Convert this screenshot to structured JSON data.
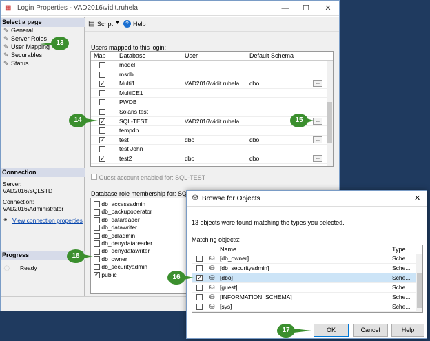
{
  "window": {
    "title": "Login Properties - VAD2016\\vidit.ruhela",
    "minimize": "—",
    "maximize": "☐",
    "close": "✕"
  },
  "left": {
    "select_page": "Select a page",
    "pages": [
      "General",
      "Server Roles",
      "User Mapping",
      "Securables",
      "Status"
    ],
    "connection_header": "Connection",
    "server_label": "Server:",
    "server_value": "VAD2016\\SQLSTD",
    "connection_label": "Connection:",
    "connection_value": "VAD2016\\Administrator",
    "view_props": "View connection properties",
    "progress_header": "Progress",
    "progress_status": "Ready"
  },
  "toolbar": {
    "script": "Script",
    "help": "Help"
  },
  "mapping": {
    "label": "Users mapped to this login:",
    "columns": [
      "Map",
      "Database",
      "User",
      "Default Schema"
    ],
    "rows": [
      {
        "map": false,
        "db": "model",
        "user": "",
        "schema": "",
        "ell": false
      },
      {
        "map": false,
        "db": "msdb",
        "user": "",
        "schema": "",
        "ell": false
      },
      {
        "map": true,
        "db": "Multi1",
        "user": "VAD2016\\vidit.ruhela",
        "schema": "dbo",
        "ell": true
      },
      {
        "map": false,
        "db": "MultiCE1",
        "user": "",
        "schema": "",
        "ell": false
      },
      {
        "map": false,
        "db": "PWDB",
        "user": "",
        "schema": "",
        "ell": false
      },
      {
        "map": false,
        "db": "Solaris test",
        "user": "",
        "schema": "",
        "ell": false
      },
      {
        "map": true,
        "db": "SQL-TEST",
        "user": "VAD2016\\vidit.ruhela",
        "schema": "",
        "ell": true
      },
      {
        "map": false,
        "db": "tempdb",
        "user": "",
        "schema": "",
        "ell": false
      },
      {
        "map": true,
        "db": "test",
        "user": "dbo",
        "schema": "dbo",
        "ell": true
      },
      {
        "map": false,
        "db": "test John",
        "user": "",
        "schema": "",
        "ell": false
      },
      {
        "map": true,
        "db": "test2",
        "user": "dbo",
        "schema": "dbo",
        "ell": true
      }
    ],
    "guest": "Guest account enabled for: SQL-TEST"
  },
  "roles": {
    "label": "Database role membership for: SQL-TEST",
    "items": [
      {
        "name": "db_accessadmin",
        "on": false
      },
      {
        "name": "db_backupoperator",
        "on": false
      },
      {
        "name": "db_datareader",
        "on": false
      },
      {
        "name": "db_datawriter",
        "on": false
      },
      {
        "name": "db_ddladmin",
        "on": false
      },
      {
        "name": "db_denydatareader",
        "on": false
      },
      {
        "name": "db_denydatawriter",
        "on": false
      },
      {
        "name": "db_owner",
        "on": false
      },
      {
        "name": "db_securityadmin",
        "on": false
      },
      {
        "name": "public",
        "on": true
      }
    ]
  },
  "dialog": {
    "title": "Browse for Objects",
    "close": "✕",
    "found": "13 objects were found matching the types you selected.",
    "matching": "Matching objects:",
    "columns": [
      "Name",
      "Type"
    ],
    "rows": [
      {
        "name": "[db_owner]",
        "type": "Sche...",
        "on": false
      },
      {
        "name": "[db_securityadmin]",
        "type": "Sche...",
        "on": false
      },
      {
        "name": "[dbo]",
        "type": "Sche...",
        "on": true
      },
      {
        "name": "[guest]",
        "type": "Sche...",
        "on": false
      },
      {
        "name": "[INFORMATION_SCHEMA]",
        "type": "Sche...",
        "on": false
      },
      {
        "name": "[sys]",
        "type": "Sche...",
        "on": false
      }
    ],
    "ok": "OK",
    "cancel": "Cancel",
    "help": "Help"
  },
  "badges": {
    "b13": "13",
    "b14": "14",
    "b15": "15",
    "b16": "16",
    "b17": "17",
    "b18": "18"
  },
  "colors": {
    "badge": "#3b8f2e",
    "selection": "#cce4f7"
  }
}
